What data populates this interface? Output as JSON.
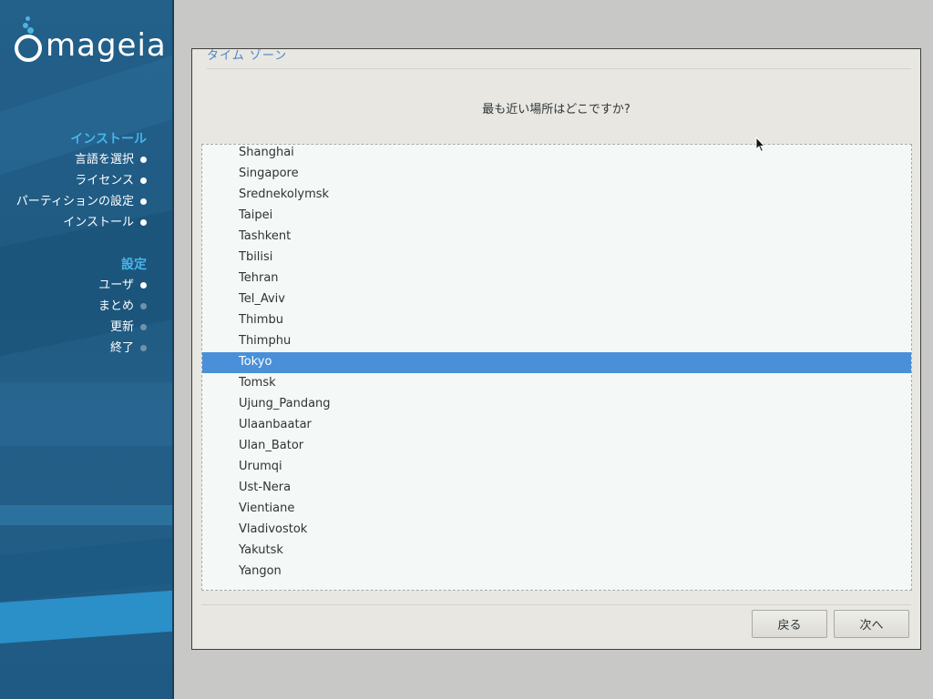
{
  "sidebar": {
    "logo_text": "mageia",
    "install_header": "インストール",
    "install_steps": [
      {
        "label": "言語を選択",
        "done": true
      },
      {
        "label": "ライセンス",
        "done": true
      },
      {
        "label": "パーティションの設定",
        "done": true
      },
      {
        "label": "インストール",
        "done": true
      }
    ],
    "config_header": "設定",
    "config_steps": [
      {
        "label": "ユーザ",
        "done": true
      },
      {
        "label": "まとめ",
        "done": false
      },
      {
        "label": "更新",
        "done": false
      },
      {
        "label": "終了",
        "done": false
      }
    ]
  },
  "dialog": {
    "title": "タイム ゾーン",
    "question": "最も近い場所はどこですか?",
    "selected": "Tokyo",
    "locations": [
      "Shanghai",
      "Singapore",
      "Srednekolymsk",
      "Taipei",
      "Tashkent",
      "Tbilisi",
      "Tehran",
      "Tel_Aviv",
      "Thimbu",
      "Thimphu",
      "Tokyo",
      "Tomsk",
      "Ujung_Pandang",
      "Ulaanbaatar",
      "Ulan_Bator",
      "Urumqi",
      "Ust-Nera",
      "Vientiane",
      "Vladivostok",
      "Yakutsk",
      "Yangon"
    ],
    "back_label": "戻る",
    "next_label": "次へ"
  },
  "colors": {
    "accent": "#4a90d9",
    "sidebar_header": "#48b4ea",
    "dialog_title": "#4a86c8"
  }
}
